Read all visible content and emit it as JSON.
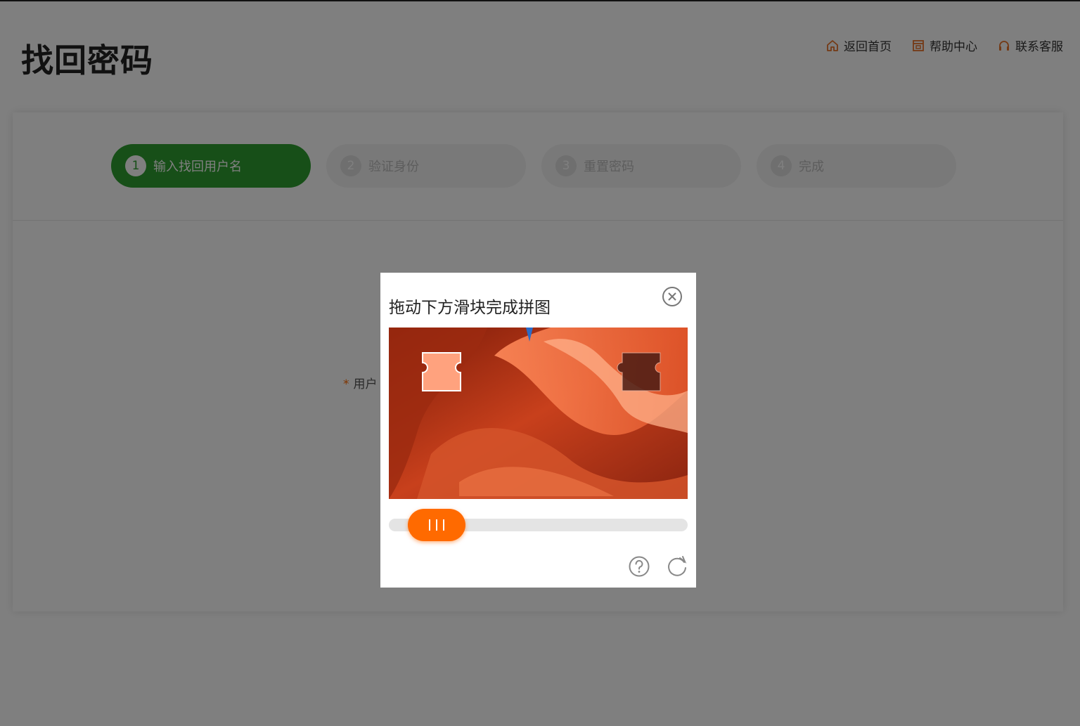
{
  "header": {
    "title": "找回密码",
    "links": [
      {
        "label": "返回首页",
        "icon": "home-icon"
      },
      {
        "label": "帮助中心",
        "icon": "help-center-icon"
      },
      {
        "label": "联系客服",
        "icon": "headset-icon"
      }
    ]
  },
  "steps": [
    {
      "num": "1",
      "label": "输入找回用户名",
      "active": true
    },
    {
      "num": "2",
      "label": "验证身份"
    },
    {
      "num": "3",
      "label": "重置密码"
    },
    {
      "num": "4",
      "label": "完成"
    }
  ],
  "form": {
    "required_mark": "*",
    "username_label": "用户"
  },
  "captcha": {
    "title": "拖动下方滑块完成拼图",
    "slider_progress": 0.08
  },
  "colors": {
    "accent": "#ff6a00",
    "step_active": "#2f9e30",
    "link_icon": "#e8742a"
  }
}
